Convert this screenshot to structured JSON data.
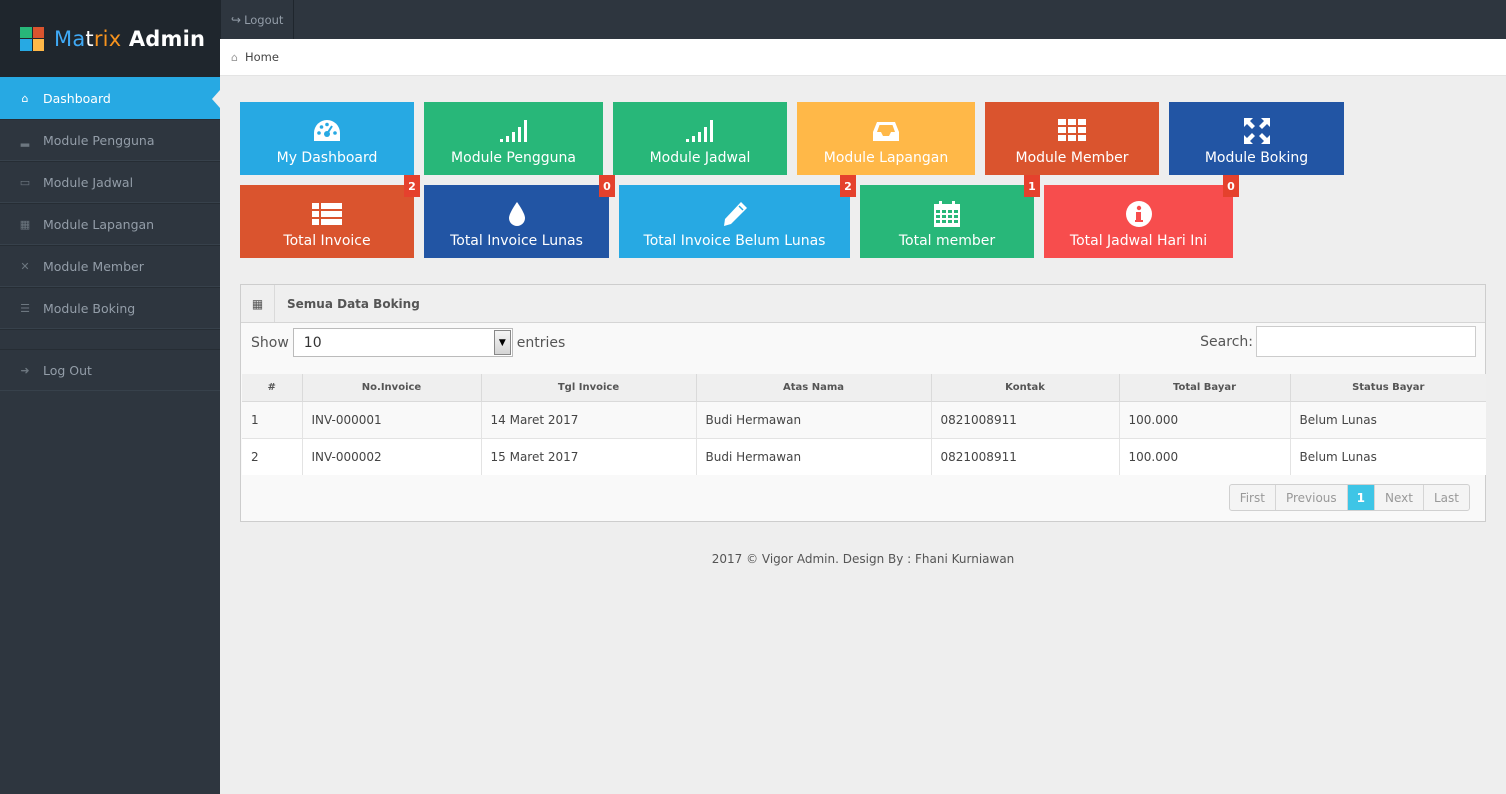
{
  "brand": {
    "part1": "Ma",
    "part2": "t",
    "part3": "rix",
    "part4": " Admin"
  },
  "topbar": {
    "logout_label": "Logout"
  },
  "breadcrumb": {
    "home": "Home"
  },
  "sidebar": {
    "items": [
      {
        "label": "Dashboard",
        "icon": "home-icon"
      },
      {
        "label": "Module Pengguna",
        "icon": "signal-icon"
      },
      {
        "label": "Module Jadwal",
        "icon": "inbox-icon"
      },
      {
        "label": "Module Lapangan",
        "icon": "grid-icon"
      },
      {
        "label": "Module Member",
        "icon": "fullscreen-icon"
      },
      {
        "label": "Module Boking",
        "icon": "list-icon"
      },
      {
        "label": "Log Out",
        "icon": "logout-icon"
      }
    ]
  },
  "tiles_row1": [
    {
      "label": "My Dashboard",
      "color": "#27a9e3"
    },
    {
      "label": "Module Pengguna",
      "color": "#28b779"
    },
    {
      "label": "Module Jadwal",
      "color": "#28b779"
    },
    {
      "label": "Module Lapangan",
      "color": "#ffb848"
    },
    {
      "label": "Module Member",
      "color": "#da542e"
    },
    {
      "label": "Module Boking",
      "color": "#2255a4"
    }
  ],
  "tiles_row2": [
    {
      "label": "Total Invoice",
      "badge": "2",
      "color": "#da542e"
    },
    {
      "label": "Total Invoice Lunas",
      "badge": "0",
      "color": "#2255a4"
    },
    {
      "label": "Total Invoice Belum Lunas",
      "badge": "2",
      "color": "#27a9e3"
    },
    {
      "label": "Total member",
      "badge": "1",
      "color": "#28b779"
    },
    {
      "label": "Total Jadwal Hari Ini",
      "badge": "0",
      "color": "#f74d4d"
    }
  ],
  "widget": {
    "title": "Semua Data Boking",
    "show_label": "Show",
    "entries_value": "10",
    "entries_label": "entries",
    "search_label": "Search:",
    "columns": [
      "#",
      "No.Invoice",
      "Tgl Invoice",
      "Atas Nama",
      "Kontak",
      "Total Bayar",
      "Status Bayar"
    ],
    "rows": [
      [
        "1",
        "INV-000001",
        "14 Maret 2017",
        "Budi Hermawan",
        "0821008911",
        "100.000",
        "Belum Lunas"
      ],
      [
        "2",
        "INV-000002",
        "15 Maret 2017",
        "Budi Hermawan",
        "0821008911",
        "100.000",
        "Belum Lunas"
      ]
    ],
    "pager": {
      "first": "First",
      "previous": "Previous",
      "current": "1",
      "next": "Next",
      "last": "Last"
    }
  },
  "footer": {
    "text": "2017 © Vigor Admin. Design By : Fhani Kurniawan"
  }
}
